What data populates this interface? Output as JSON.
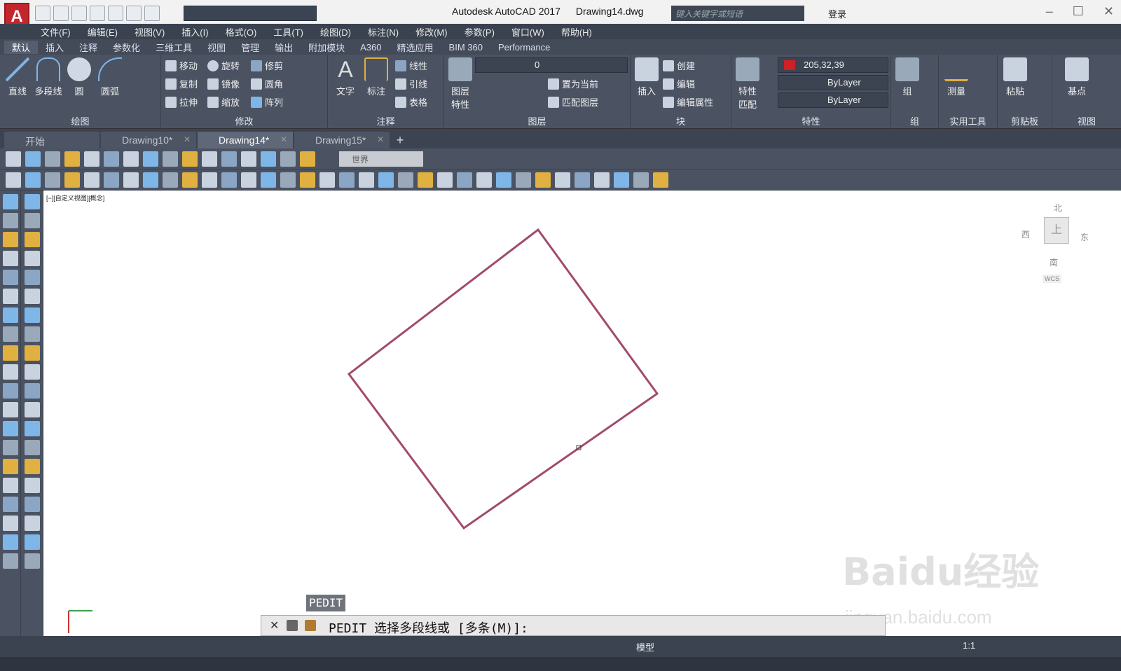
{
  "titlebar": {
    "app_logo": "A",
    "app_name": "Autodesk AutoCAD 2017",
    "doc_name": "Drawing14.dwg",
    "search_placeholder": "键入关键字或短语",
    "login": "登录"
  },
  "menu": [
    "文件(F)",
    "编辑(E)",
    "视图(V)",
    "插入(I)",
    "格式(O)",
    "工具(T)",
    "绘图(D)",
    "标注(N)",
    "修改(M)",
    "参数(P)",
    "窗口(W)",
    "帮助(H)"
  ],
  "ribbon_tabs": [
    "默认",
    "插入",
    "注释",
    "参数化",
    "三维工具",
    "视图",
    "管理",
    "输出",
    "附加模块",
    "A360",
    "精选应用",
    "BIM 360",
    "Performance"
  ],
  "ribbon": {
    "draw": {
      "title": "绘图",
      "line": "直线",
      "pline": "多段线",
      "circle": "圆",
      "arc": "圆弧"
    },
    "modify": {
      "title": "修改",
      "move": "移动",
      "rotate": "旋转",
      "trim": "修剪",
      "copy": "复制",
      "mirror": "镜像",
      "fillet": "圆角",
      "stretch": "拉伸",
      "scale": "缩放",
      "array": "阵列"
    },
    "annotation": {
      "title": "注释",
      "text": "文字",
      "dim": "标注",
      "linear": "线性",
      "leader": "引线",
      "table": "表格"
    },
    "layers": {
      "title": "图层",
      "props": "图层\n特性",
      "current_layer": "0",
      "make_current": "置为当前",
      "match": "匹配图层"
    },
    "block": {
      "title": "块",
      "insert": "插入",
      "create": "创建",
      "edit": "编辑",
      "edit_attr": "编辑属性"
    },
    "properties": {
      "title": "特性",
      "match": "特性\n匹配",
      "color": "205,32,39",
      "linetype": "ByLayer",
      "lineweight": "ByLayer"
    },
    "groups": {
      "title": "组",
      "group": "组"
    },
    "utilities": {
      "title": "实用工具",
      "measure": "测量"
    },
    "clipboard": {
      "title": "剪贴板",
      "paste": "粘贴"
    },
    "view": {
      "title": "视图",
      "base": "基点"
    }
  },
  "doc_tabs": [
    "开始",
    "Drawing10*",
    "Drawing14*",
    "Drawing15*"
  ],
  "ucs_combo": "世界",
  "viewport_label": "[−][自定义视图][概念]",
  "viewcube": {
    "north": "北",
    "south": "南",
    "east": "东",
    "west": "西",
    "top": "上",
    "wcs": "WCS"
  },
  "command": {
    "tooltip": "PEDIT",
    "prompt": "PEDIT 选择多段线或 [多条(M)]: "
  },
  "status": {
    "model": "模型",
    "scale": "1:1"
  },
  "watermark": {
    "text": "Baidu经验",
    "url": "jingyan.baidu.com"
  },
  "colors": {
    "polyline": "#a24a6e",
    "swatch": "#cd2027",
    "ribbon_bg": "#4b5363"
  }
}
